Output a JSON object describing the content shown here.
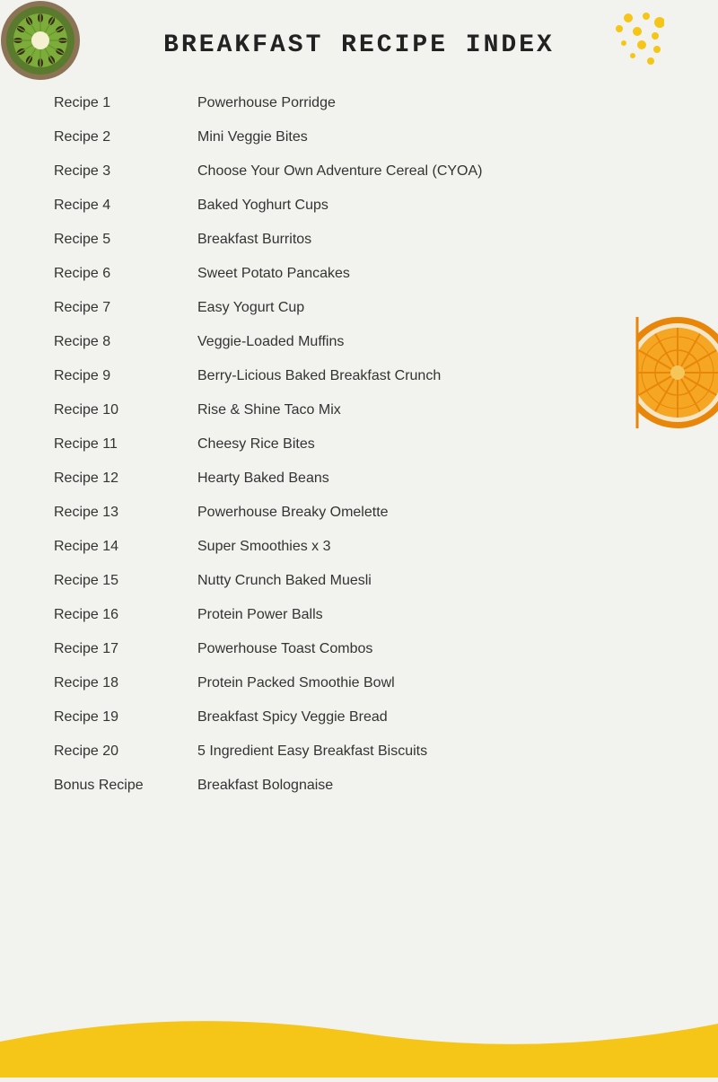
{
  "page": {
    "title": "BREAKFAST RECIPE INDEX",
    "background_color": "#f2f2ee"
  },
  "recipes": [
    {
      "number": "Recipe 1",
      "name": "Powerhouse Porridge"
    },
    {
      "number": "Recipe 2",
      "name": "Mini Veggie Bites"
    },
    {
      "number": "Recipe 3",
      "name": "Choose Your Own Adventure Cereal (CYOA)"
    },
    {
      "number": "Recipe 4",
      "name": "Baked Yoghurt Cups"
    },
    {
      "number": "Recipe 5",
      "name": "Breakfast Burritos"
    },
    {
      "number": "Recipe 6",
      "name": "Sweet Potato Pancakes"
    },
    {
      "number": "Recipe 7",
      "name": "Easy Yogurt Cup"
    },
    {
      "number": "Recipe 8",
      "name": "Veggie-Loaded Muffins"
    },
    {
      "number": "Recipe 9",
      "name": "Berry-Licious Baked Breakfast Crunch"
    },
    {
      "number": "Recipe 10",
      "name": "Rise & Shine Taco Mix"
    },
    {
      "number": "Recipe 11",
      "name": "Cheesy Rice Bites"
    },
    {
      "number": "Recipe 12",
      "name": "Hearty Baked Beans"
    },
    {
      "number": "Recipe 13",
      "name": "Powerhouse Breaky Omelette"
    },
    {
      "number": "Recipe 14",
      "name": "Super Smoothies x 3"
    },
    {
      "number": "Recipe 15",
      "name": "Nutty Crunch Baked Muesli"
    },
    {
      "number": "Recipe 16",
      "name": "Protein Power Balls"
    },
    {
      "number": "Recipe 17",
      "name": "Powerhouse Toast Combos"
    },
    {
      "number": "Recipe 18",
      "name": "Protein Packed Smoothie Bowl"
    },
    {
      "number": "Recipe 19",
      "name": "Breakfast Spicy Veggie Bread"
    },
    {
      "number": "Recipe 20",
      "name": "5 Ingredient Easy Breakfast Biscuits"
    },
    {
      "number": "Bonus Recipe",
      "name": "Breakfast Bolognaise"
    }
  ]
}
